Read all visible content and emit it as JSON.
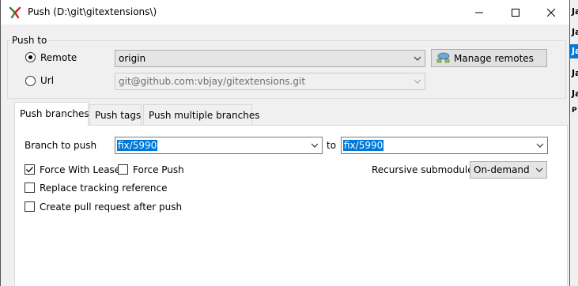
{
  "window": {
    "title": "Push (D:\\git\\gitextensions\\)"
  },
  "background_rows": [
    "Ja",
    "Ja",
    "Ja",
    "Ja",
    "Ja",
    "P"
  ],
  "push_to": {
    "group_label": "Push to",
    "remote_label": "Remote",
    "remote_value": "origin",
    "manage_remotes_label": "Manage remotes",
    "url_label": "Url",
    "url_value": "git@github.com:vbjay/gitextensions.git",
    "selected": "Remote"
  },
  "tabs": [
    {
      "label": "Push branches",
      "active": true
    },
    {
      "label": "Push tags",
      "active": false
    },
    {
      "label": "Push multiple branches",
      "active": false
    }
  ],
  "branches": {
    "branch_label": "Branch to push",
    "branch_value": "fix/5990",
    "to_label": "to",
    "remote_branch_value": "fix/5990",
    "force_with_lease_label": "Force With Lease",
    "force_with_lease_checked": true,
    "force_push_label": "Force Push",
    "force_push_checked": false,
    "recursive_label": "Recursive submodules",
    "recursive_value": "On-demand",
    "replace_tracking_label": "Replace tracking reference",
    "replace_tracking_checked": false,
    "create_pr_label": "Create pull request after push",
    "create_pr_checked": false
  },
  "colors": {
    "selection": "#0078d7",
    "window_bg": "#f0f0f0",
    "panel_bg": "#ffffff"
  },
  "icons": {
    "app": "git-extensions-logo-icon",
    "manage_remotes": "remotes-network-icon"
  }
}
